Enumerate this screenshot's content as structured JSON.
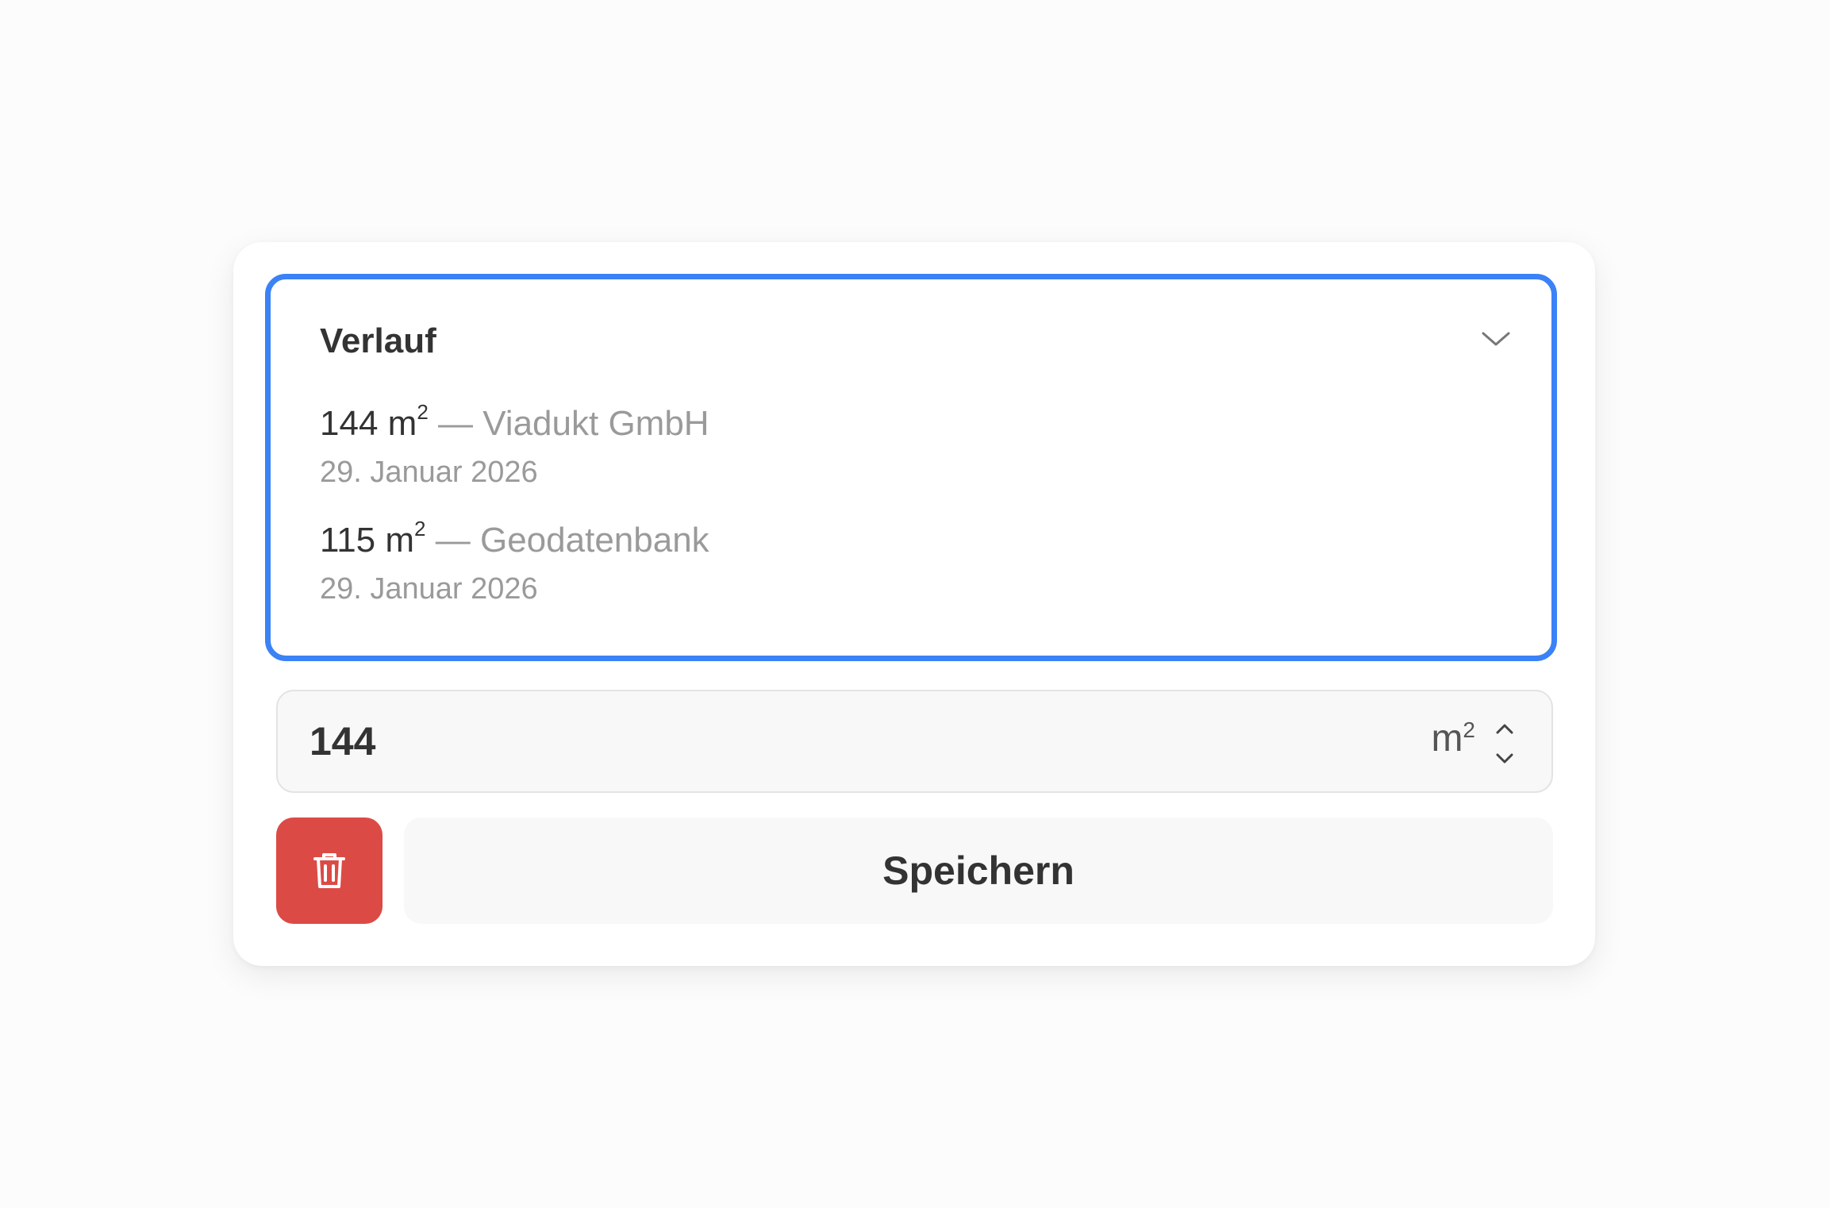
{
  "history": {
    "title": "Verlauf",
    "entries": [
      {
        "value": "144",
        "unit": "m",
        "unit_sup": "2",
        "separator": "—",
        "source": "Viadukt GmbH",
        "date": "29. Januar 2026"
      },
      {
        "value": "115",
        "unit": "m",
        "unit_sup": "2",
        "separator": "—",
        "source": "Geodatenbank",
        "date": "29. Januar 2026"
      }
    ]
  },
  "input": {
    "value": "144",
    "unit": "m",
    "unit_sup": "2"
  },
  "actions": {
    "save_label": "Speichern"
  },
  "colors": {
    "focus_border": "#3b82f6",
    "delete_button": "#dc4a46",
    "muted_text": "#9a9a9a",
    "primary_text": "#333333"
  },
  "icons": {
    "collapse": "chevron-down-icon",
    "delete": "trash-icon",
    "increment": "chevron-up-icon",
    "decrement": "chevron-down-icon"
  }
}
